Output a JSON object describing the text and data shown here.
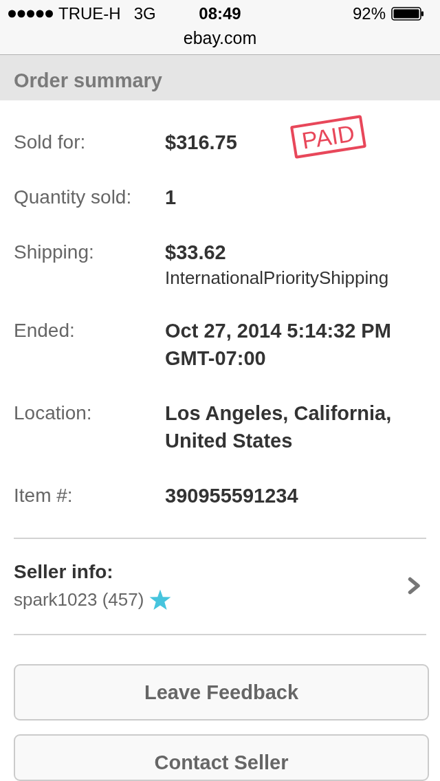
{
  "status_bar": {
    "carrier": "TRUE-H",
    "network": "3G",
    "time": "08:49",
    "battery": "92%"
  },
  "address_bar": {
    "url": "ebay.com"
  },
  "section": {
    "title": "Order summary"
  },
  "details": [
    {
      "label": "Sold for:",
      "value": "$316.75",
      "stamp": "PAID"
    },
    {
      "label": "Quantity sold:",
      "value": "1"
    },
    {
      "label": "Shipping:",
      "value": "$33.62",
      "note": "InternationalPriorityShipping"
    },
    {
      "label": "Ended:",
      "value": "Oct 27, 2014 5:14:32 PM GMT-07:00"
    },
    {
      "label": "Location:",
      "value": "Los Angeles, California, United States"
    },
    {
      "label": "Item #:",
      "value": "390955591234"
    }
  ],
  "seller": {
    "heading": "Seller info:",
    "name": "spark1023 (457)"
  },
  "buttons": [
    "Leave Feedback",
    "Contact Seller"
  ]
}
